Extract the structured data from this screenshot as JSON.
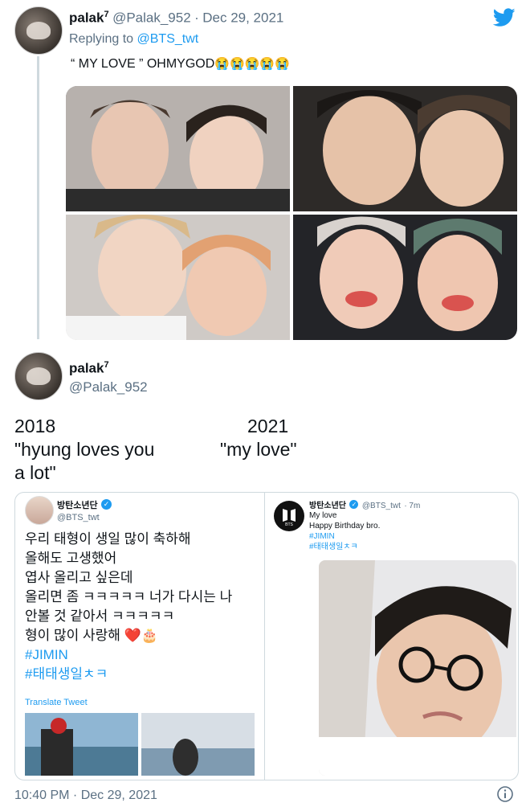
{
  "tweet1": {
    "name": "palak",
    "name_sup": "7",
    "handle": "@Palak_952",
    "separator": "·",
    "date": "Dec 29, 2021",
    "replying_prefix": "Replying to",
    "replying_to": "@BTS_twt",
    "text": "“ MY LOVE ” OHMYGOD",
    "emojis": "😭😭😭😭😭"
  },
  "tweet2": {
    "name": "palak",
    "name_sup": "7",
    "handle": "@Palak_952",
    "left_year": "2018",
    "left_line1": "\"hyung loves you",
    "left_line2": "a lot\"",
    "right_year": "2021",
    "right_line1": "\"my love\"",
    "timestamp": "10:40 PM · Dec 29, 2021"
  },
  "left_card": {
    "name": "방탄소년단",
    "handle": "@BTS_twt",
    "lines": [
      "우리 태형이 생일 많이 축하해",
      "올해도 고생했어",
      "엽사 올리고 싶은데",
      "올리면 좀 ㅋㅋㅋㅋㅋ 너가 다시는 나",
      "안볼 것 같아서 ㅋㅋㅋㅋㅋ",
      "형이 많이 사랑해"
    ],
    "line_emojis": "❤️🎂",
    "hashtag1": "#JIMIN",
    "hashtag2": "#태태생일ㅊㅋ",
    "translate": "Translate Tweet"
  },
  "right_card": {
    "name": "방탄소년단",
    "handle": "@BTS_twt",
    "time": "· 7m",
    "line1": "My love",
    "line2": "Happy Birthday bro.",
    "hashtag1": "#JIMIN",
    "hashtag2": "#태태생일ㅊㅋ",
    "logo_text": "BTS"
  },
  "colors": {
    "twitter_blue": "#1d9bf0",
    "secondary_text": "#5b7083",
    "border": "#cfd9de"
  },
  "icons": {
    "twitter": "twitter-bird-icon",
    "verified": "verified-badge-icon",
    "info": "info-icon"
  }
}
